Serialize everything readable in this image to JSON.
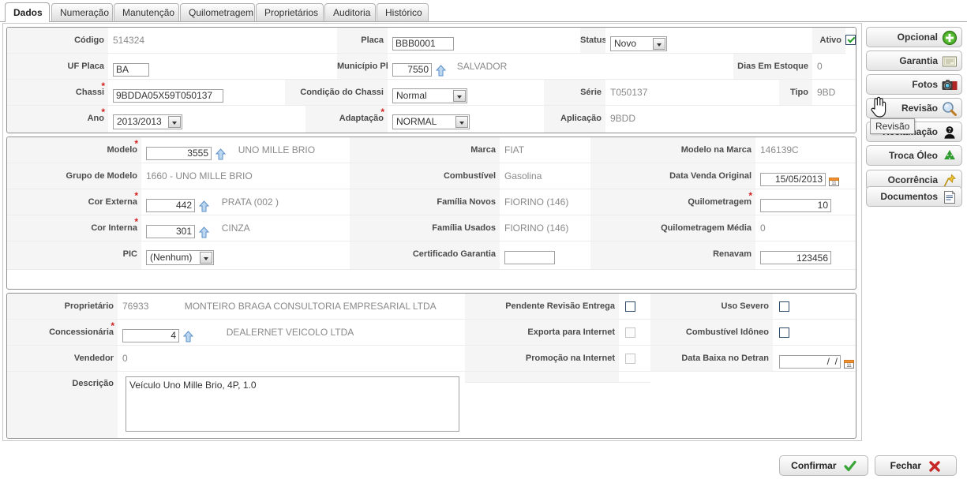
{
  "tabs": [
    {
      "label": "Dados",
      "active": true
    },
    {
      "label": "Numeração",
      "active": false
    },
    {
      "label": "Manutenção",
      "active": false
    },
    {
      "label": "Quilometragem",
      "active": false
    },
    {
      "label": "Proprietários",
      "active": false
    },
    {
      "label": "Auditoria",
      "active": false
    },
    {
      "label": "Histórico",
      "active": false
    }
  ],
  "section1": {
    "codigo": {
      "label": "Código",
      "value": "514324"
    },
    "placa": {
      "label": "Placa",
      "value": "BBB0001"
    },
    "status": {
      "label": "Status",
      "value": "Novo"
    },
    "ativo": {
      "label": "Ativo",
      "checked": true
    },
    "uf_placa": {
      "label": "UF Placa",
      "value": "BA"
    },
    "municipio_placa": {
      "label": "Município Placa",
      "value": "7550",
      "desc": "SALVADOR",
      "icon": "lookup-arrow-icon"
    },
    "dias_em_estoque": {
      "label": "Dias Em Estoque",
      "value": "0"
    },
    "chassi": {
      "label": "Chassi",
      "value": "9BDDA05X59T050137",
      "required": true
    },
    "condicao_chassi": {
      "label": "Condição do Chassi",
      "value": "Normal"
    },
    "serie": {
      "label": "Série",
      "value": "T050137"
    },
    "tipo": {
      "label": "Tipo",
      "value": "9BD"
    },
    "ano": {
      "label": "Ano",
      "value": "2013/2013",
      "required": true
    },
    "adaptacao": {
      "label": "Adaptação",
      "value": "NORMAL",
      "required": true
    },
    "aplicacao": {
      "label": "Aplicação",
      "value": "9BDD"
    }
  },
  "section2": {
    "modelo": {
      "label": "Modelo",
      "value": "3555",
      "desc": "UNO MILLE BRIO",
      "required": true,
      "icon": "lookup-arrow-icon"
    },
    "marca": {
      "label": "Marca",
      "value": "FIAT"
    },
    "modelo_na_marca": {
      "label": "Modelo na Marca",
      "value": "146139C"
    },
    "grupo_de_modelo": {
      "label": "Grupo de Modelo",
      "value": "1660 - UNO MILLE BRIO"
    },
    "combustivel": {
      "label": "Combustível",
      "value": "Gasolina"
    },
    "data_venda_original": {
      "label": "Data Venda Original",
      "value": "15/05/2013",
      "icon": "calendar-icon"
    },
    "cor_externa": {
      "label": "Cor Externa",
      "value": "442",
      "desc": "PRATA (002 )",
      "required": true,
      "icon": "lookup-arrow-icon"
    },
    "familia_novos": {
      "label": "Família Novos",
      "value": "FIORINO (146)"
    },
    "quilometragem": {
      "label": "Quilometragem",
      "value": "10",
      "required": true
    },
    "cor_interna": {
      "label": "Cor Interna",
      "value": "301",
      "desc": "CINZA",
      "required": true,
      "icon": "lookup-arrow-icon"
    },
    "familia_usados": {
      "label": "Família Usados",
      "value": "FIORINO (146)"
    },
    "quilometragem_media": {
      "label": "Quilometragem Média",
      "value": "0"
    },
    "pic": {
      "label": "PIC",
      "value": "(Nenhum)"
    },
    "certificado_garantia": {
      "label": "Certificado Garantia",
      "value": ""
    },
    "renavam": {
      "label": "Renavam",
      "value": "123456"
    }
  },
  "section3": {
    "proprietario": {
      "label": "Proprietário",
      "value": "76933",
      "desc": "MONTEIRO BRAGA CONSULTORIA EMPRESARIAL LTDA"
    },
    "concessionaria": {
      "label": "Concessionária",
      "value": "4",
      "desc": "DEALERNET VEICOLO LTDA",
      "required": true,
      "icon": "lookup-arrow-icon"
    },
    "vendedor": {
      "label": "Vendedor",
      "value": "0"
    },
    "descricao": {
      "label": "Descrição",
      "value": "Veículo Uno Mille Brio, 4P, 1.0"
    },
    "pendente_revisao_entrega": {
      "label": "Pendente Revisão Entrega",
      "checked": false,
      "disabled": false
    },
    "uso_severo": {
      "label": "Uso Severo",
      "checked": false,
      "disabled": false
    },
    "exporta_para_internet": {
      "label": "Exporta para Internet",
      "checked": false,
      "disabled": true
    },
    "combustivel_idoneo": {
      "label": "Combustível Idôneo",
      "checked": false,
      "disabled": false
    },
    "promocao_na_internet": {
      "label": "Promoção na Internet",
      "checked": false,
      "disabled": true
    },
    "data_baixa_no_detran": {
      "label": "Data Baixa no Detran",
      "value": "  /  /",
      "icon": "calendar-icon"
    }
  },
  "side_buttons": [
    {
      "label": "Opcional",
      "icon": "green-plus-circle-icon"
    },
    {
      "label": "Garantia",
      "icon": "certificate-icon"
    },
    {
      "label": "Fotos",
      "icon": "camera-icon"
    },
    {
      "label": "Revisão",
      "icon": "magnifier-icon"
    },
    {
      "label": "Reclamação",
      "icon": "person-question-icon"
    },
    {
      "label": "Troca Óleo",
      "icon": "recycle-icon"
    },
    {
      "label": "Ocorrência",
      "icon": "pushpin-icon"
    },
    {
      "label": "Documentos",
      "icon": "document-list-icon"
    }
  ],
  "tooltip": {
    "text": "Revisão"
  },
  "footer": {
    "confirmar": {
      "label": "Confirmar",
      "icon": "green-check-icon"
    },
    "fechar": {
      "label": "Fechar",
      "icon": "red-x-icon"
    }
  },
  "colors": {
    "required_star": "#d02020",
    "label_bg": "#f5f5f5",
    "readonly_text": "#8a8a8a",
    "accent_green": "#1f9c1f",
    "accent_red": "#c62828"
  }
}
